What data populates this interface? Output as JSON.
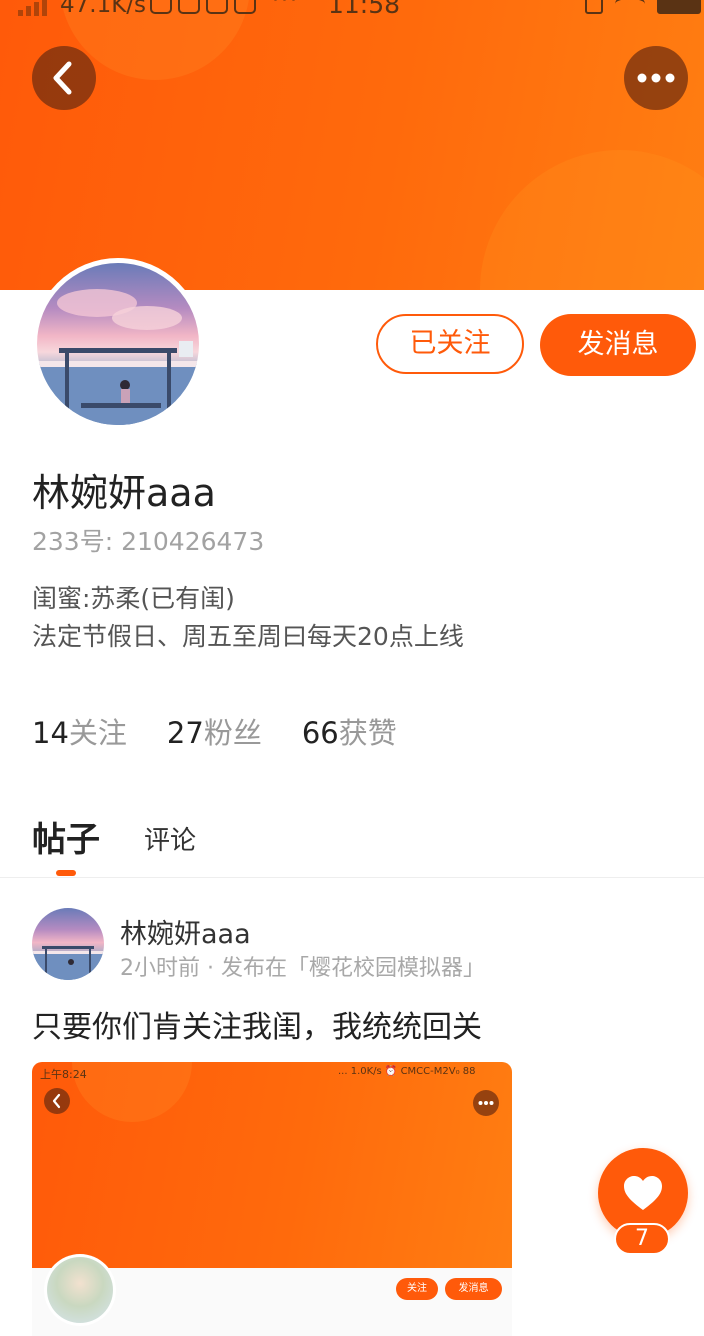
{
  "status_bar": {
    "net_speed": "47.1K/s",
    "more": "···",
    "time": "11:58"
  },
  "profile": {
    "username": "林婉妍aaa",
    "id_label": "233号:",
    "id_value": "210426473",
    "bio_line1": "闺蜜:苏柔(已有闺)",
    "bio_line2": "法定节假日、周五至周曰每天20点上线",
    "follow_button": "已关注",
    "message_button": "发消息"
  },
  "stats": [
    {
      "num": "14",
      "label": "关注"
    },
    {
      "num": "27",
      "label": "粉丝"
    },
    {
      "num": "66",
      "label": "获赞"
    }
  ],
  "tabs": {
    "posts": "帖子",
    "comments": "评论"
  },
  "post": {
    "author": "林婉妍aaa",
    "meta": "2小时前 · 发布在「樱花校园模拟器」",
    "text": "只要你们肯关注我闺，我统统回关",
    "image": {
      "status_left": "上午8:24",
      "status_right": "... 1.0K/s ⏰ CMCC-M2V₀ 88",
      "follow": "关注",
      "message": "发消息"
    }
  },
  "like": {
    "count": "7"
  },
  "icons": {
    "back": "chevron-left-icon",
    "more": "more-dots-icon",
    "like": "heart-icon"
  },
  "colors": {
    "accent": "#ff5a0a",
    "header": "#ff6a0c"
  }
}
